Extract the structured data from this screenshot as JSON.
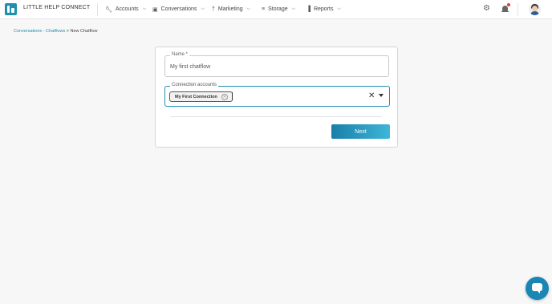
{
  "app": {
    "title": "LITTLE HELP CONNECT"
  },
  "nav": {
    "items": [
      {
        "label": "Accounts",
        "icon": "wrench-icon"
      },
      {
        "label": "Conversations",
        "icon": "chat-icon"
      },
      {
        "label": "Marketing",
        "icon": "broadcast-icon"
      },
      {
        "label": "Storage",
        "icon": "list-icon"
      },
      {
        "label": "Reports",
        "icon": "bar-chart-icon"
      }
    ]
  },
  "breadcrumb": {
    "link": "Conversations - Chatflows",
    "separator": " > ",
    "current": "New Chatflow"
  },
  "form": {
    "name_label": "Name *",
    "name_value": "My first chatflow",
    "connection_label": "Connection accounts",
    "selected_connection": "My First Connection",
    "next_label": "Next"
  },
  "colors": {
    "accent": "#1d8fb0",
    "notification_dot": "#e53935"
  }
}
